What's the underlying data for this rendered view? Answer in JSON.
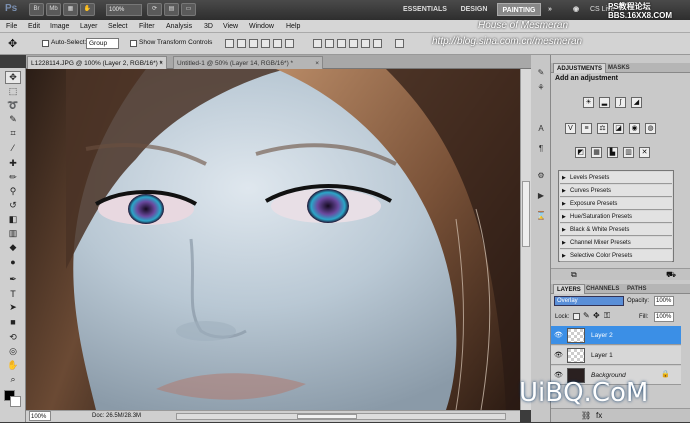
{
  "titlebar": {
    "app_logo": "Ps",
    "zoom": "100%",
    "workspaces": [
      "ESSENTIALS",
      "DESIGN",
      "PAINTING"
    ],
    "active_workspace": "PAINTING",
    "cs_live": "CS Live"
  },
  "watermarks": {
    "house": "House of Mesmeran",
    "blog": "http://blog.sina.com.cn/mesmeran",
    "site_top_cn": "PS教程论坛",
    "site_top": "BBS.16XX8.COM",
    "uibq": "UiBQ.CoM"
  },
  "menu": [
    "File",
    "Edit",
    "Image",
    "Layer",
    "Select",
    "Filter",
    "Analysis",
    "3D",
    "View",
    "Window",
    "Help"
  ],
  "options": {
    "auto_select_label": "Auto-Select:",
    "auto_select_value": "Group",
    "transform_label": "Show Transform Controls"
  },
  "tabs": [
    {
      "label": "L1228114.JPG @ 100% (Layer 2, RGB/16*) *"
    },
    {
      "label": "Untitled-1 @ 50% (Layer 14, RGB/16*) *"
    }
  ],
  "status": {
    "zoom": "100%",
    "doc": "Doc: 26.5M/28.3M"
  },
  "adjustments": {
    "tab_adjustments": "ADJUSTMENTS",
    "tab_masks": "MASKS",
    "heading": "Add an adjustment",
    "presets": [
      "Levels Presets",
      "Curves Presets",
      "Exposure Presets",
      "Hue/Saturation Presets",
      "Black & White Presets",
      "Channel Mixer Presets",
      "Selective Color Presets"
    ]
  },
  "layers": {
    "tab_layers": "LAYERS",
    "tab_channels": "CHANNELS",
    "tab_paths": "PATHS",
    "blend_mode": "Overlay",
    "opacity_label": "Opacity:",
    "opacity": "100%",
    "lock_label": "Lock:",
    "fill_label": "Fill:",
    "fill": "100%",
    "items": [
      {
        "name": "Layer 2",
        "selected": true
      },
      {
        "name": "Layer 1",
        "selected": false
      },
      {
        "name": "Background",
        "selected": false
      }
    ]
  },
  "colors": {
    "selection": "#3b8fe6",
    "blend_field": "#5a8fd8",
    "workspace_bg": "#3c3c3c"
  }
}
